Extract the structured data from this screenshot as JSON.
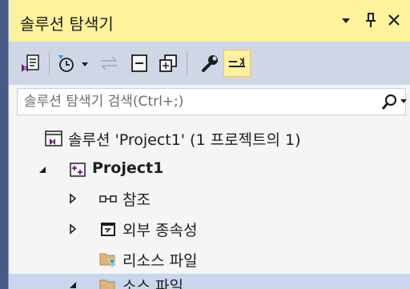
{
  "panel": {
    "title": "솔루션 탐색기"
  },
  "search": {
    "placeholder": "솔루션 탐색기 검색(Ctrl+;)"
  },
  "tree": {
    "solution": "솔루션 'Project1' (1 프로젝트의 1)",
    "project": "Project1",
    "references": "참조",
    "external_deps": "외부 종속성",
    "resource_files": "리소스 파일",
    "source_files": "소스 파일"
  },
  "colors": {
    "title_active": "#FFF29D",
    "toolbar_bg": "#CFD6E5",
    "chrome_frame": "#475985",
    "solution_purple": "#68217A"
  },
  "icons": {
    "title_menu": "dropdown-arrow-icon",
    "title_pin": "pin-icon",
    "title_close": "close-icon"
  }
}
